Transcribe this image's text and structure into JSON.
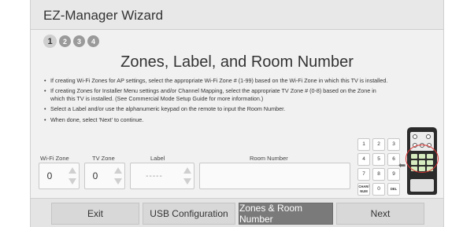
{
  "window": {
    "title": "EZ-Manager Wizard"
  },
  "steps": [
    "1",
    "2",
    "3",
    "4"
  ],
  "heading": "Zones, Label, and Room Number",
  "instructions": [
    "If creating Wi-Fi Zones for AP settings, select the appropriate Wi-Fi Zone # (1-99) based on the Wi-Fi Zone in which this TV is installed.",
    "If creating Zones for Installer Menu settings and/or Channel Mapping, select the appropriate TV Zone # (0-8) based on the Zone in which this TV is installed. (See Commercial Mode Setup Guide for more information.)",
    "Select a Label and/or use the alphanumeric keypad on the remote to input the Room Number.",
    "When done, select 'Next' to continue."
  ],
  "fields": {
    "wifi_zone": {
      "label": "Wi-Fi Zone",
      "value": "0"
    },
    "tv_zone": {
      "label": "TV Zone",
      "value": "0"
    },
    "label": {
      "label": "Label",
      "value": "-----"
    },
    "room_number": {
      "label": "Room Number",
      "value": ""
    }
  },
  "keypad": [
    "1",
    "2",
    "3",
    "4",
    "5",
    "6",
    "7",
    "8",
    "9",
    "CHAR/ NUM",
    "0",
    "DEL"
  ],
  "buttons": {
    "exit": "Exit",
    "usb": "USB Configuration",
    "zones": "Zones & Room Number",
    "next": "Next"
  },
  "colors": {
    "selected_button": "#7a7a7a",
    "remote_highlight": "#dd3333"
  },
  "icons": {
    "remote": "remote-control-icon",
    "arrow": "arrow-left-icon"
  }
}
